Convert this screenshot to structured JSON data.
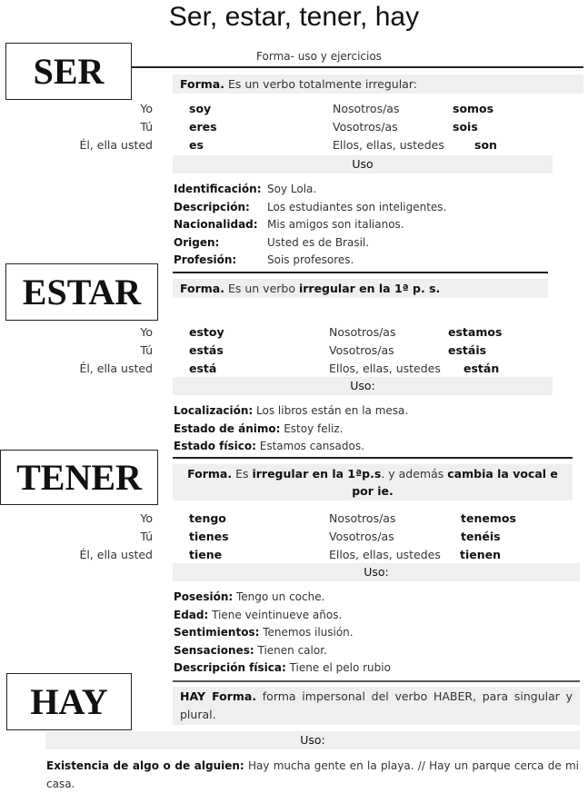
{
  "title": "Ser, estar, tener, hay",
  "subtitle": "Forma- uso y ejercicios",
  "sections": {
    "ser": {
      "verb_label": "SER",
      "forma_label": "Forma.",
      "forma_text": " Es un verbo totalmente irregular:",
      "conjugation": [
        {
          "pronoun": "Yo",
          "form": "soy",
          "pronoun_pl": "Nosotros/as",
          "form_pl": "somos"
        },
        {
          "pronoun": "Tú",
          "form": "eres",
          "pronoun_pl": "Vosotros/as",
          "form_pl": "sois"
        },
        {
          "pronoun": "Él, ella usted",
          "form": "es",
          "pronoun_pl": "Ellos, ellas, ustedes",
          "form_pl": "son"
        }
      ],
      "uso_label": "Uso",
      "usos": [
        {
          "label": "Identificación:",
          "example": "Soy Lola."
        },
        {
          "label": "Descripción:",
          "example": "Los estudiantes son inteligentes."
        },
        {
          "label": "Nacionalidad:",
          "example": "Mis amigos son italianos."
        },
        {
          "label": "Origen:",
          "example": "Usted es de Brasil."
        },
        {
          "label": "Profesión:",
          "example": "Sois profesores."
        }
      ]
    },
    "estar": {
      "verb_label": "ESTAR",
      "forma_label": "Forma.",
      "forma_text_1": " Es un verbo ",
      "forma_bold": "irregular en la 1ª p. s.",
      "conjugation": [
        {
          "pronoun": "Yo",
          "form": "estoy",
          "pronoun_pl": "Nosotros/as",
          "form_pl": "estamos"
        },
        {
          "pronoun": "Tú",
          "form": "estás",
          "pronoun_pl": "Vosotros/as",
          "form_pl": "estáis"
        },
        {
          "pronoun": "Él, ella usted",
          "form": "está",
          "pronoun_pl": "Ellos, ellas, ustedes",
          "form_pl": "están"
        }
      ],
      "uso_label": "Uso:",
      "usos": [
        {
          "label": "Localización:",
          "example": " Los libros están en la mesa."
        },
        {
          "label": "Estado de ánimo:",
          "example": " Estoy feliz."
        },
        {
          "label": "Estado físico:",
          "example": " Estamos cansados."
        }
      ]
    },
    "tener": {
      "verb_label": "TENER",
      "forma_label": "Forma.",
      "forma_text_1": " Es ",
      "forma_bold_1": "irregular en la 1ªp.s",
      "forma_text_2": ". y además ",
      "forma_bold_2": "cambia la vocal e por ie.",
      "conjugation": [
        {
          "pronoun": "Yo",
          "form": "tengo",
          "pronoun_pl": "Nosotros/as",
          "form_pl": "tenemos"
        },
        {
          "pronoun": "Tú",
          "form": "tienes",
          "pronoun_pl": "Vosotros/as",
          "form_pl": "tenéis"
        },
        {
          "pronoun": "Él, ella usted",
          "form": "tiene",
          "pronoun_pl": "Ellos, ellas, ustedes",
          "form_pl": "tienen"
        }
      ],
      "uso_label": "Uso:",
      "usos": [
        {
          "label": "Posesión:",
          "example": " Tengo un coche."
        },
        {
          "label": "Edad:",
          "example": " Tiene veintinueve años."
        },
        {
          "label": "Sentimientos:",
          "example": " Tenemos ilusión."
        },
        {
          "label": "Sensaciones:",
          "example": " Tienen calor."
        },
        {
          "label": "Descripción física:",
          "example": " Tiene el pelo rubio"
        }
      ]
    },
    "hay": {
      "verb_label": "HAY",
      "forma_label": "HAY Forma.",
      "forma_text": " forma impersonal del verbo HABER, para singular y plural.",
      "uso_label": "Uso:",
      "usos": [
        {
          "label": "Existencia de algo o de alguien:",
          "example": " Hay mucha gente en la playa. // Hay un parque cerca de mi casa."
        }
      ]
    }
  }
}
